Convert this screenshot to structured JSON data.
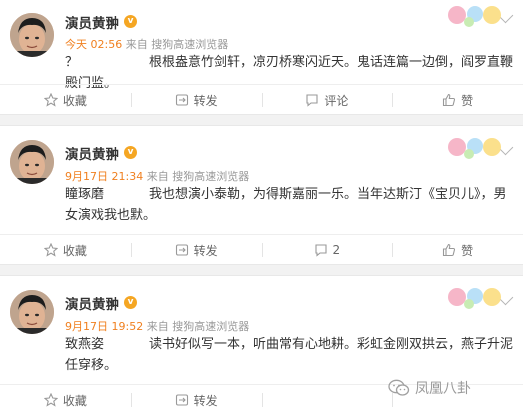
{
  "posts": [
    {
      "username": "演员黄翀",
      "verified_badge": "v",
      "time": "今天 02:56",
      "source": "来自 搜狗高速浏览器",
      "nick": "？",
      "text": "根根盎意竹剑轩，凉刃桥寒闪近天。鬼话连篇一边倒，阎罗直鞭殿门监。",
      "actions": {
        "favorite": "收藏",
        "repost": "转发",
        "comment": "评论",
        "like": "赞"
      }
    },
    {
      "username": "演员黄翀",
      "verified_badge": "v",
      "time": "9月17日 21:34",
      "source": "来自 搜狗高速浏览器",
      "nick": "瞳琢磨",
      "text": "我也想演小泰勒，为得斯嘉丽一乐。当年达斯汀《宝贝儿》，男女演戏我也默。",
      "actions": {
        "favorite": "收藏",
        "repost": "转发",
        "comment": "2",
        "like": "赞"
      }
    },
    {
      "username": "演员黄翀",
      "verified_badge": "v",
      "time": "9月17日 19:52",
      "source": "来自 搜狗高速浏览器",
      "nick": "致燕姿",
      "text": "读书好似写一本，听曲常有心地耕。彩虹金刚双拱云，燕子升泥任穿移。",
      "actions": {
        "favorite": "收藏",
        "repost": "转发"
      }
    }
  ],
  "watermark": "凤凰八卦",
  "colors": {
    "accent": "#f08020",
    "muted": "#999999",
    "badge": "#f5a623",
    "separator": "#f2f2f2"
  }
}
